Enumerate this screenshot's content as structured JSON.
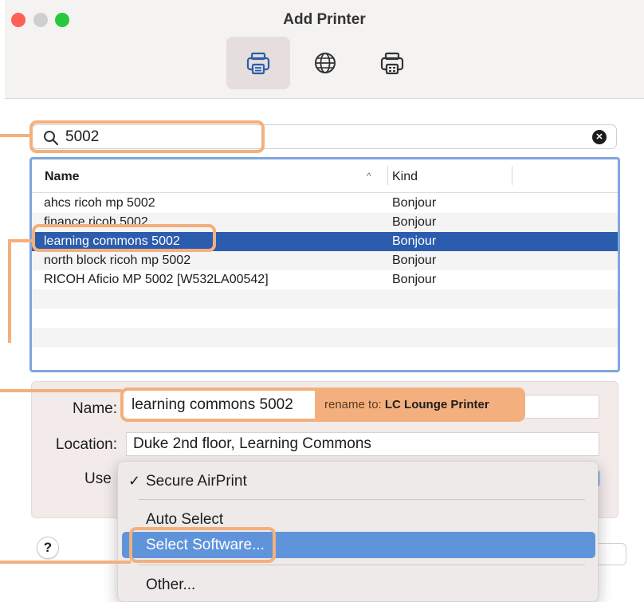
{
  "window": {
    "title": "Add Printer"
  },
  "toolbar": {
    "tabs": [
      {
        "icon": "printer-icon",
        "selected": true
      },
      {
        "icon": "globe-icon",
        "selected": false
      },
      {
        "icon": "windows-printer-icon",
        "selected": false
      }
    ]
  },
  "search": {
    "value": "5002",
    "clear_icon": "clear-icon"
  },
  "list": {
    "columns": [
      "Name",
      "Kind"
    ],
    "rows": [
      {
        "name": "ahcs ricoh mp 5002",
        "kind": "Bonjour",
        "selected": false
      },
      {
        "name": "finance ricoh 5002",
        "kind": "Bonjour",
        "selected": false
      },
      {
        "name": "learning commons 5002",
        "kind": "Bonjour",
        "selected": true
      },
      {
        "name": "north block ricoh mp 5002",
        "kind": "Bonjour",
        "selected": false
      },
      {
        "name": "RICOH Aficio MP 5002 [W532LA00542]",
        "kind": "Bonjour",
        "selected": false
      }
    ]
  },
  "form": {
    "name_label": "Name:",
    "name_value": "learning commons 5002",
    "location_label": "Location:",
    "location_value": "Duke 2nd floor, Learning Commons",
    "use_label": "Use"
  },
  "use_menu": {
    "items": [
      {
        "label": "Secure AirPrint",
        "checked": true
      },
      {
        "label": "Auto Select"
      },
      {
        "label": "Select Software...",
        "highlighted": true
      },
      {
        "label": "Other..."
      }
    ]
  },
  "help_label": "?",
  "annotations": {
    "rename_prefix": "rename to: ",
    "rename_target": "LC Lounge Printer",
    "color": "#f3b07e"
  },
  "colors": {
    "selection": "#2b5cad",
    "menu_highlight": "#5f94db",
    "list_border": "#7ea6dd"
  }
}
